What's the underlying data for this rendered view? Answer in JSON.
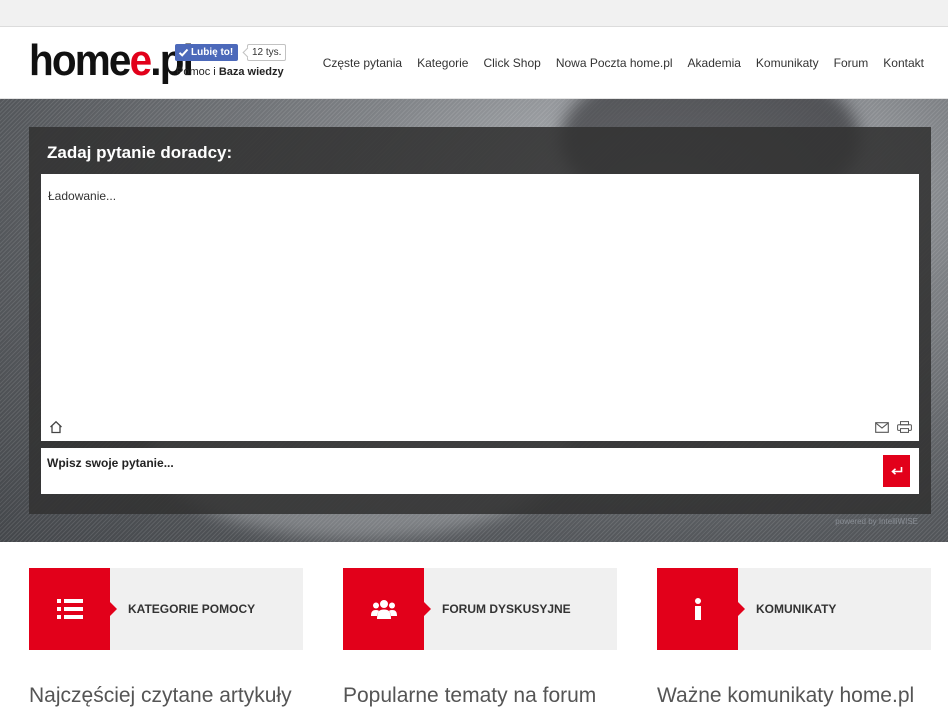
{
  "header": {
    "logo_main": "home",
    "logo_accent": "e",
    "logo_tail": ".pl",
    "fb_like_label": "Lubię to!",
    "fb_like_count": "12 tys.",
    "subtitle_prefix": "Pomoc i",
    "subtitle_bold": "Baza wiedzy"
  },
  "nav": {
    "items": [
      {
        "label": "Częste pytania"
      },
      {
        "label": "Kategorie"
      },
      {
        "label": "Click Shop"
      },
      {
        "label": "Nowa Poczta home.pl"
      },
      {
        "label": "Akademia"
      },
      {
        "label": "Komunikaty"
      },
      {
        "label": "Forum"
      },
      {
        "label": "Kontakt"
      }
    ]
  },
  "chat": {
    "title": "Zadaj pytanie doradcy:",
    "loading_text": "Ładowanie...",
    "input_placeholder": "Wpisz swoje pytanie...",
    "powered_by": "powered by IntelliWISE",
    "icons": [
      "home-icon",
      "mail-icon",
      "print-icon",
      "enter-icon"
    ]
  },
  "cards": [
    {
      "label": "KATEGORIE POMOCY",
      "icon": "list-icon"
    },
    {
      "label": "FORUM DYSKUSYJNE",
      "icon": "users-icon"
    },
    {
      "label": "KOMUNIKATY",
      "icon": "info-icon"
    }
  ],
  "sections": [
    {
      "title": "Najczęściej czytane artykuły"
    },
    {
      "title": "Popularne tematy na forum"
    },
    {
      "title": "Ważne komunikaty home.pl"
    }
  ],
  "colors": {
    "accent": "#e2001a",
    "facebook": "#4c69ba",
    "card_bg": "#f0f0f0",
    "chat_bg": "#323232"
  }
}
